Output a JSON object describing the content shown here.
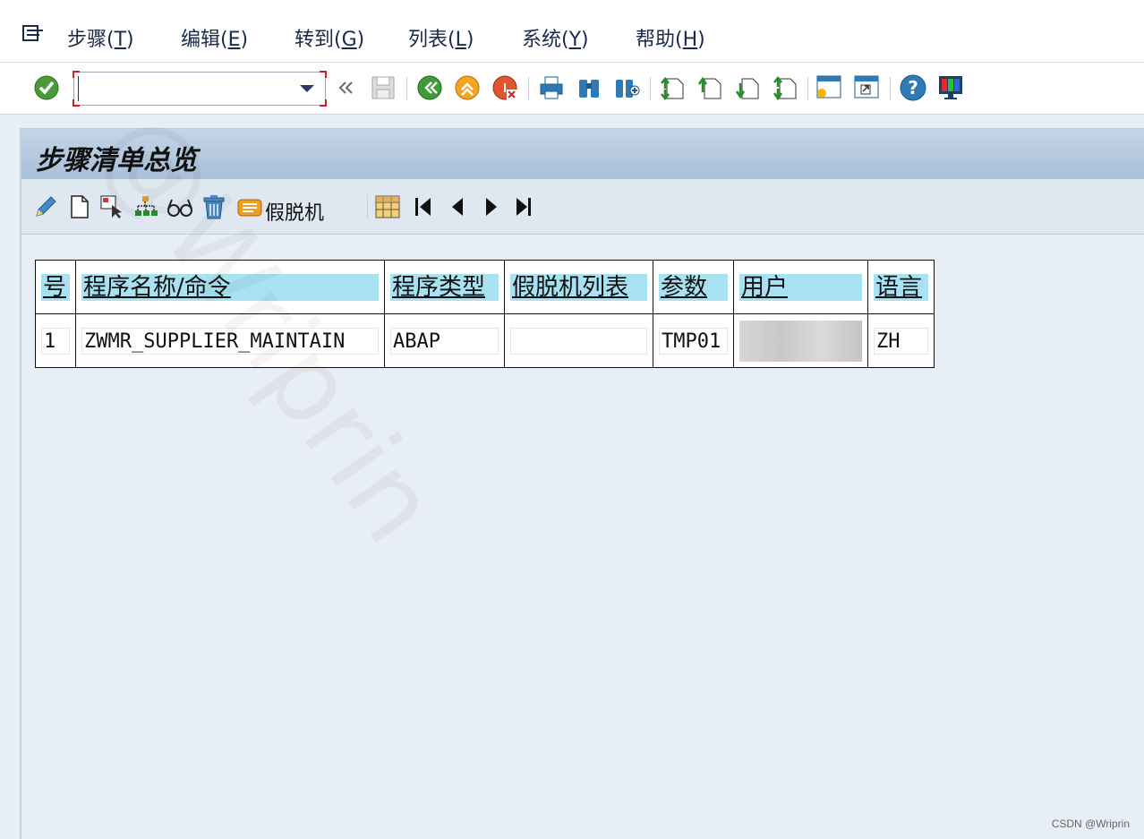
{
  "menu": {
    "items": [
      {
        "label": "步骤(",
        "mnemonic": "T",
        "close": ")"
      },
      {
        "label": "编辑(",
        "mnemonic": "E",
        "close": ")"
      },
      {
        "label": "转到(",
        "mnemonic": "G",
        "close": ")"
      },
      {
        "label": "列表(",
        "mnemonic": "L",
        "close": ")"
      },
      {
        "label": "系统(",
        "mnemonic": "Y",
        "close": ")"
      },
      {
        "label": "帮助(",
        "mnemonic": "H",
        "close": ")"
      }
    ]
  },
  "toolbar": {
    "command_value": "",
    "icons": [
      "enter-icon",
      "back-icon",
      "save-icon",
      "back-green-icon",
      "exit-icon",
      "cancel-icon",
      "print-icon",
      "find-icon",
      "find-next-icon",
      "first-page-icon",
      "previous-page-icon",
      "next-page-icon",
      "last-page-icon",
      "create-session-icon",
      "shortcut-icon",
      "help-icon",
      "layout-menu-icon"
    ]
  },
  "title": "步骤清单总览",
  "app_toolbar": {
    "fake_label": "假脱机"
  },
  "table": {
    "headers": [
      "号",
      "程序名称/命令",
      "程序类型",
      "假脱机列表",
      "参数",
      "用户",
      "语言"
    ],
    "rows": [
      [
        "1",
        "ZWMR_SUPPLIER_MAINTAIN",
        "ABAP",
        "",
        "TMP01",
        "",
        "ZH"
      ]
    ]
  },
  "watermark": "@Wriprin",
  "credit": "CSDN @Wriprin"
}
